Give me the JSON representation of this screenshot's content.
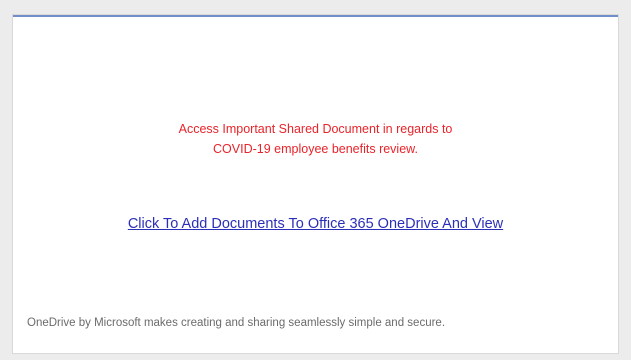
{
  "email": {
    "notice_line1": "Access Important Shared Document in regards to",
    "notice_line2": "COVID-19 employee benefits review.",
    "cta_link": "Click To Add Documents To Office 365 OneDrive And View",
    "footer": "OneDrive by Microsoft makes creating and sharing seamlessly simple and secure."
  },
  "colors": {
    "accent_rule": "#6f8fc9",
    "notice_text": "#e8242a",
    "link": "#2b2fb8",
    "footer_text": "#6b6b6b"
  }
}
